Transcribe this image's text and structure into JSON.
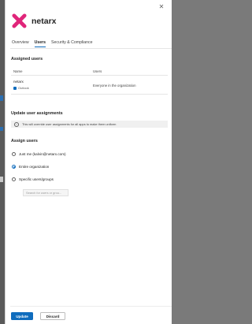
{
  "brand": {
    "name": "netarx",
    "accent": "#e0257a"
  },
  "tabs": [
    {
      "label": "Overview",
      "active": false
    },
    {
      "label": "Users",
      "active": true
    },
    {
      "label": "Security & Compliance",
      "active": false
    }
  ],
  "assigned_users": {
    "heading": "Assigned users",
    "columns": [
      "Name",
      "Users"
    ],
    "rows": [
      {
        "name": "netarx",
        "app": "Outlook",
        "users": "Everyone in the organization"
      }
    ]
  },
  "update_assignments": {
    "heading": "Update user assignments",
    "notice": "This will override user assignments for all apps to make them uniform"
  },
  "assign_users": {
    "heading": "Assign users",
    "options": [
      {
        "label": "Just me (kalvin@netarx.com)",
        "selected": false
      },
      {
        "label": "Entire organization",
        "selected": true
      },
      {
        "label": "Specific users/groups",
        "selected": false
      }
    ],
    "search_placeholder": "Search for users or grou..."
  },
  "footer": {
    "update_label": "Update",
    "discard_label": "Discard"
  },
  "colors": {
    "primary": "#0f6cbd",
    "text": "#242424",
    "backdrop": "#6b6b6b"
  }
}
